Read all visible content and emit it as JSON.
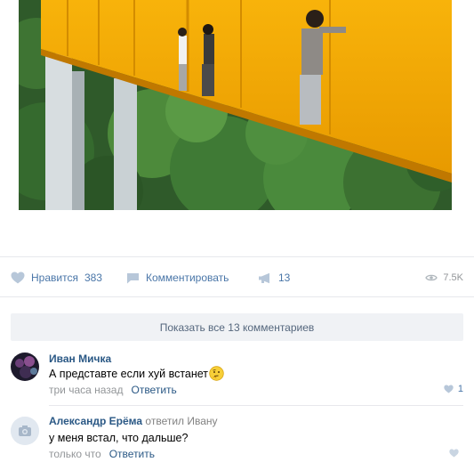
{
  "post": {
    "image_alt": "photo",
    "actions": {
      "like_label": "Нравится",
      "like_count": "383",
      "comment_label": "Комментировать",
      "share_count": "13",
      "views_count": "7.5K"
    },
    "show_all_comments": "Показать все 13 комментариев"
  },
  "comments": [
    {
      "author": "Иван Мичка",
      "text": "А представте если хуй встанет",
      "emoji": "thinking-face-icon",
      "time": "три часа назад",
      "reply_label": "Ответить",
      "likes": "1"
    },
    {
      "author": "Александр Ерёма",
      "replied_to": "ответил Ивану",
      "text": "у меня встал, что дальше?",
      "time": "только что",
      "reply_label": "Ответить",
      "likes": ""
    }
  ],
  "colors": {
    "link": "#2a5885",
    "action": "#4a76a8",
    "muted": "#939699",
    "show_all_bg": "#f0f2f5",
    "beam": "#f5a500"
  }
}
